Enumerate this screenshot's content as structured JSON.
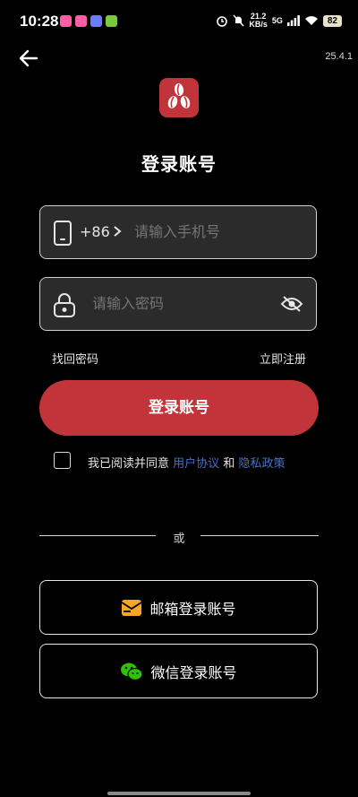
{
  "status_bar": {
    "time": "10:28",
    "net_speed_value": "21.2",
    "net_speed_unit": "KB/s",
    "signal_label": "5G",
    "battery": "82"
  },
  "header": {
    "version": "25.4.1"
  },
  "page_title": "登录账号",
  "phone_field": {
    "country_code": "+86",
    "placeholder": "请输入手机号"
  },
  "password_field": {
    "placeholder": "请输入密码"
  },
  "links": {
    "forgot_password": "找回密码",
    "register": "立即注册"
  },
  "login_button": "登录账号",
  "agreement": {
    "prefix": "我已阅读并同意",
    "user_agreement": "用户协议",
    "conjunction": "和",
    "privacy_policy": "隐私政策"
  },
  "divider_text": "或",
  "alt_logins": {
    "email": "邮箱登录账号",
    "wechat": "微信登录账号"
  },
  "colors": {
    "accent": "#c1353a",
    "link": "#4a70c7",
    "background": "#000000"
  }
}
